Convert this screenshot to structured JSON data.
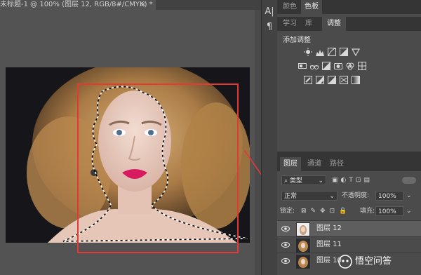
{
  "document": {
    "tab_title": "未标题-1 @ 100% (图层 12, RGB/8#/CMYK) *",
    "close_glyph": "×"
  },
  "toolbar": {
    "text_tool": "A|",
    "paragraph_tool": "¶"
  },
  "panels": {
    "top_tabs": [
      "颜色",
      "色板"
    ],
    "adjust_tabs": [
      "学习",
      "库",
      "调整"
    ],
    "adjust_title": "添加调整"
  },
  "layers_panel": {
    "tabs": [
      "图层",
      "通道",
      "路径"
    ],
    "filter_kind": "类型",
    "blend_mode": "正常",
    "opacity_label": "不透明度:",
    "opacity_value": "100%",
    "lock_label": "锁定:",
    "fill_label": "填充:",
    "fill_value": "100%",
    "layers": [
      {
        "name": "图层 12",
        "selected": true
      },
      {
        "name": "图层 11",
        "selected": false
      },
      {
        "name": "图层 10",
        "selected": false
      }
    ]
  },
  "watermark": {
    "text": "悟空问答"
  },
  "colors": {
    "selection_rect": "#e53935",
    "arrow": "#e53935",
    "lipstick": "#d81b60"
  }
}
